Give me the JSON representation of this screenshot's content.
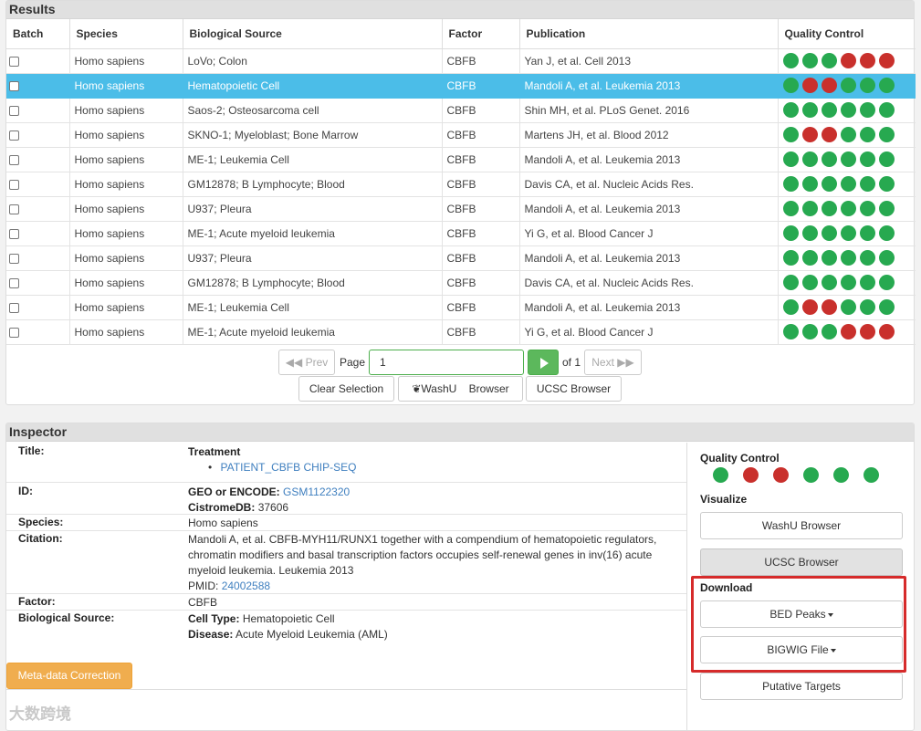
{
  "results": {
    "title": "Results",
    "columns": [
      "Batch",
      "Species",
      "Biological Source",
      "Factor",
      "Publication",
      "Quality Control"
    ],
    "rows": [
      {
        "species": "Homo sapiens",
        "source": "LoVo; Colon",
        "factor": "CBFB",
        "pub": "Yan J, et al. Cell 2013",
        "qc": "gggrrr",
        "selected": false
      },
      {
        "species": "Homo sapiens",
        "source": "Hematopoietic Cell",
        "factor": "CBFB",
        "pub": "Mandoli A, et al. Leukemia 2013",
        "qc": "grrggg",
        "selected": true
      },
      {
        "species": "Homo sapiens",
        "source": "Saos-2; Osteosarcoma cell",
        "factor": "CBFB",
        "pub": "Shin MH, et al. PLoS Genet. 2016",
        "qc": "gggggg",
        "selected": false
      },
      {
        "species": "Homo sapiens",
        "source": "SKNO-1; Myeloblast; Bone Marrow",
        "factor": "CBFB",
        "pub": "Martens JH, et al. Blood 2012",
        "qc": "grrggg",
        "selected": false
      },
      {
        "species": "Homo sapiens",
        "source": "ME-1; Leukemia Cell",
        "factor": "CBFB",
        "pub": "Mandoli A, et al. Leukemia 2013",
        "qc": "gggggg",
        "selected": false
      },
      {
        "species": "Homo sapiens",
        "source": "GM12878; B Lymphocyte; Blood",
        "factor": "CBFB",
        "pub": "Davis CA, et al. Nucleic Acids Res.",
        "qc": "gggggg",
        "selected": false
      },
      {
        "species": "Homo sapiens",
        "source": "U937; Pleura",
        "factor": "CBFB",
        "pub": "Mandoli A, et al. Leukemia 2013",
        "qc": "gggggg",
        "selected": false
      },
      {
        "species": "Homo sapiens",
        "source": "ME-1; Acute myeloid leukemia",
        "factor": "CBFB",
        "pub": "Yi G, et al. Blood Cancer J",
        "qc": "gggggg",
        "selected": false
      },
      {
        "species": "Homo sapiens",
        "source": "U937; Pleura",
        "factor": "CBFB",
        "pub": "Mandoli A, et al. Leukemia 2013",
        "qc": "gggggg",
        "selected": false
      },
      {
        "species": "Homo sapiens",
        "source": "GM12878; B Lymphocyte; Blood",
        "factor": "CBFB",
        "pub": "Davis CA, et al. Nucleic Acids Res.",
        "qc": "gggggg",
        "selected": false
      },
      {
        "species": "Homo sapiens",
        "source": "ME-1; Leukemia Cell",
        "factor": "CBFB",
        "pub": "Mandoli A, et al. Leukemia 2013",
        "qc": "grrggg",
        "selected": false
      },
      {
        "species": "Homo sapiens",
        "source": "ME-1; Acute myeloid leukemia",
        "factor": "CBFB",
        "pub": "Yi G, et al. Blood Cancer J",
        "qc": "gggrrr",
        "selected": false
      }
    ]
  },
  "pager": {
    "prev": "Prev",
    "page_label": "Page",
    "page_value": "1",
    "of": "of 1",
    "next": "Next",
    "clear": "Clear Selection",
    "washu": "WashU    Browser",
    "ucsc": "UCSC Browser"
  },
  "inspector": {
    "title": "Inspector",
    "labels": {
      "title": "Title:",
      "id": "ID:",
      "species": "Species:",
      "citation": "Citation:",
      "factor": "Factor:",
      "biosource": "Biological Source:"
    },
    "treatment_label": "Treatment",
    "treatment_item": "PATIENT_CBFB CHIP-SEQ",
    "geo_label": "GEO or ENCODE:",
    "geo_value": "GSM1122320",
    "cistrome_label": "CistromeDB:",
    "cistrome_value": "37606",
    "species": "Homo sapiens",
    "citation": "Mandoli A, et al. CBFB-MYH11/RUNX1 together with a compendium of hematopoietic regulators, chromatin modifiers and basal transcription factors occupies self-renewal genes in inv(16) acute myeloid leukemia. Leukemia 2013",
    "pmid_label": "PMID:",
    "pmid_value": "24002588",
    "factor": "CBFB",
    "cell_type_label": "Cell Type:",
    "cell_type": "Hematopoietic Cell",
    "disease_label": "Disease:",
    "disease": "Acute Myeloid Leukemia (AML)",
    "meta_correction": "Meta-data Correction"
  },
  "side": {
    "qc_title": "Quality Control",
    "qc": "grrggg",
    "visualize_title": "Visualize",
    "washu": "WashU Browser",
    "ucsc": "UCSC Browser",
    "download_title": "Download",
    "bed": "BED Peaks",
    "bigwig": "BIGWIG File",
    "targets": "Putative Targets"
  },
  "colors": {
    "green": "#27a950",
    "red": "#c9302c",
    "selected_row": "#4bbde8",
    "highlight": "#d62b2b"
  },
  "watermark": "大数跨境"
}
